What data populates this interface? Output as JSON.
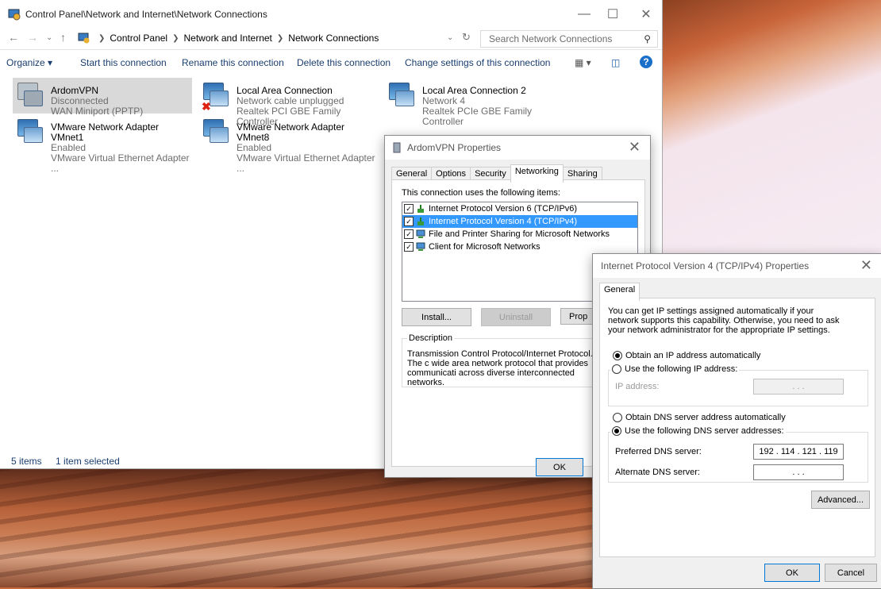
{
  "explorer": {
    "title": "Control Panel\\Network and Internet\\Network Connections",
    "breadcrumbs": [
      "Control Panel",
      "Network and Internet",
      "Network Connections"
    ],
    "search_placeholder": "Search Network Connections",
    "commands": [
      "Organize ▾",
      "Start this connection",
      "Rename this connection",
      "Delete this connection",
      "Change settings of this connection"
    ],
    "connections": [
      {
        "name": "ArdomVPN",
        "status": "Disconnected",
        "adapter": "WAN Miniport (PPTP)",
        "selected": true
      },
      {
        "name": "Local Area Connection",
        "status": "Network cable unplugged",
        "adapter": "Realtek PCI GBE Family Controller"
      },
      {
        "name": "Local Area Connection 2",
        "status": "Network 4",
        "adapter": "Realtek PCIe GBE Family Controller"
      },
      {
        "name": "VMware Network Adapter VMnet1",
        "status": "Enabled",
        "adapter": "VMware Virtual Ethernet Adapter ..."
      },
      {
        "name": "VMware Network Adapter VMnet8",
        "status": "Enabled",
        "adapter": "VMware Virtual Ethernet Adapter ..."
      }
    ],
    "status": {
      "count": "5 items",
      "selected": "1 item selected"
    }
  },
  "vpn_dialog": {
    "title": "ArdomVPN Properties",
    "tabs": [
      "General",
      "Options",
      "Security",
      "Networking",
      "Sharing"
    ],
    "items_label": "This connection uses the following items:",
    "items": [
      "Internet Protocol Version 6 (TCP/IPv6)",
      "Internet Protocol Version 4 (TCP/IPv4)",
      "File and Printer Sharing for Microsoft Networks",
      "Client for Microsoft Networks"
    ],
    "install": "Install...",
    "uninstall": "Uninstall",
    "properties": "Prop",
    "description_label": "Description",
    "description": "Transmission Control Protocol/Internet Protocol. The c wide area network protocol that provides communicati across diverse interconnected networks.",
    "ok": "OK"
  },
  "ipv4_dialog": {
    "title": "Internet Protocol Version 4 (TCP/IPv4) Properties",
    "tab": "General",
    "intro": "You can get IP settings assigned automatically if your network supports this capability. Otherwise, you need to ask your network administrator for the appropriate IP settings.",
    "obtain_ip_auto": "Obtain an IP address automatically",
    "use_following_ip": "Use the following IP address:",
    "ip_address_label": "IP address:",
    "obtain_dns_auto": "Obtain DNS server address automatically",
    "use_following_dns": "Use the following DNS server addresses:",
    "preferred_dns_label": "Preferred DNS server:",
    "preferred_dns": "192 . 114 . 121 . 119",
    "alternate_dns_label": "Alternate DNS server:",
    "empty_ip": ".   .   .",
    "advanced": "Advanced...",
    "ok": "OK",
    "cancel": "Cancel"
  }
}
